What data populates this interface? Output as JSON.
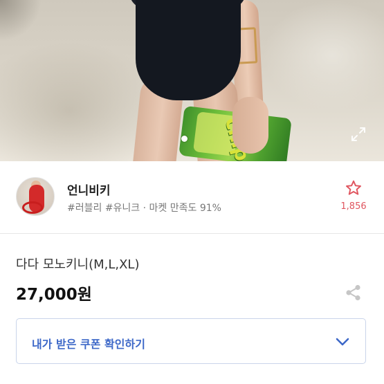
{
  "hero": {
    "bag_text": "chip",
    "icons": {
      "zoom": "expand-arrows-icon",
      "pagination": "pagination-dot"
    }
  },
  "seller": {
    "name": "언니비키",
    "tags": "#러블리 #유니크 · 마켓 만족도 91%",
    "favorite_count": "1,856",
    "icons": {
      "favorite": "star-outline-icon"
    }
  },
  "product": {
    "name": "다다 모노키니(M,L,XL)",
    "price": "27,000원",
    "icons": {
      "share": "share-icon"
    }
  },
  "coupon": {
    "label": "내가 받은 쿠폰 확인하기",
    "icons": {
      "expand": "chevron-down-icon"
    }
  },
  "colors": {
    "accent_blue": "#3d68c8",
    "favorite_red": "#e0555f",
    "coupon_border": "#c9d4ea"
  }
}
